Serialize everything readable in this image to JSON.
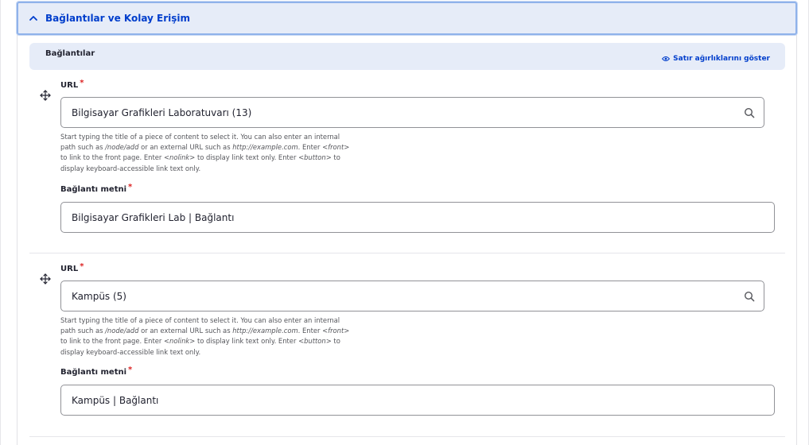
{
  "section": {
    "title": "Bağlantılar ve Kolay Erişim"
  },
  "table": {
    "header_label": "Bağlantılar",
    "weights_button": "Satır ağırlıklarını göster"
  },
  "rows": [
    {
      "url_label": "URL",
      "url_value": "Bilgisayar Grafikleri Laboratuvarı (13)",
      "desc": {
        "p1": "Start typing the title of a piece of content to select it. You can also enter an internal",
        "p2a": "path such as ",
        "p2b": "/node/add",
        "p2c": " or an external URL such as ",
        "p2d": "http://example.com",
        "p2e": ". Enter ",
        "p2f": "<front>",
        "p3a": "to link to the front page. Enter ",
        "p3b": "<nolink>",
        "p3c": " to display link text only. Enter ",
        "p3d": "<button>",
        "p3e": " to",
        "p4": "display keyboard-accessible link text only."
      },
      "text_label": "Bağlantı metni",
      "text_value": "Bilgisayar Grafikleri Lab | Bağlantı"
    },
    {
      "url_label": "URL",
      "url_value": "Kampüs (5)",
      "desc": {
        "p1": "Start typing the title of a piece of content to select it. You can also enter an internal",
        "p2a": "path such as ",
        "p2b": "/node/add",
        "p2c": " or an external URL such as ",
        "p2d": "http://example.com",
        "p2e": ". Enter ",
        "p2f": "<front>",
        "p3a": "to link to the front page. Enter ",
        "p3b": "<nolink>",
        "p3c": " to display link text only. Enter ",
        "p3d": "<button>",
        "p3e": " to",
        "p4": "display keyboard-accessible link text only."
      },
      "text_label": "Bağlantı metni",
      "text_value": "Kampüs | Bağlantı"
    }
  ],
  "required_marker": "*",
  "colors": {
    "accent": "#003ecc",
    "required": "#dc2323",
    "header_bg": "#e6ecf8"
  },
  "icons": {
    "summary": "chevron-up-icon",
    "weights": "eye-icon",
    "drag": "move-handle-icon",
    "search": "search-icon"
  }
}
